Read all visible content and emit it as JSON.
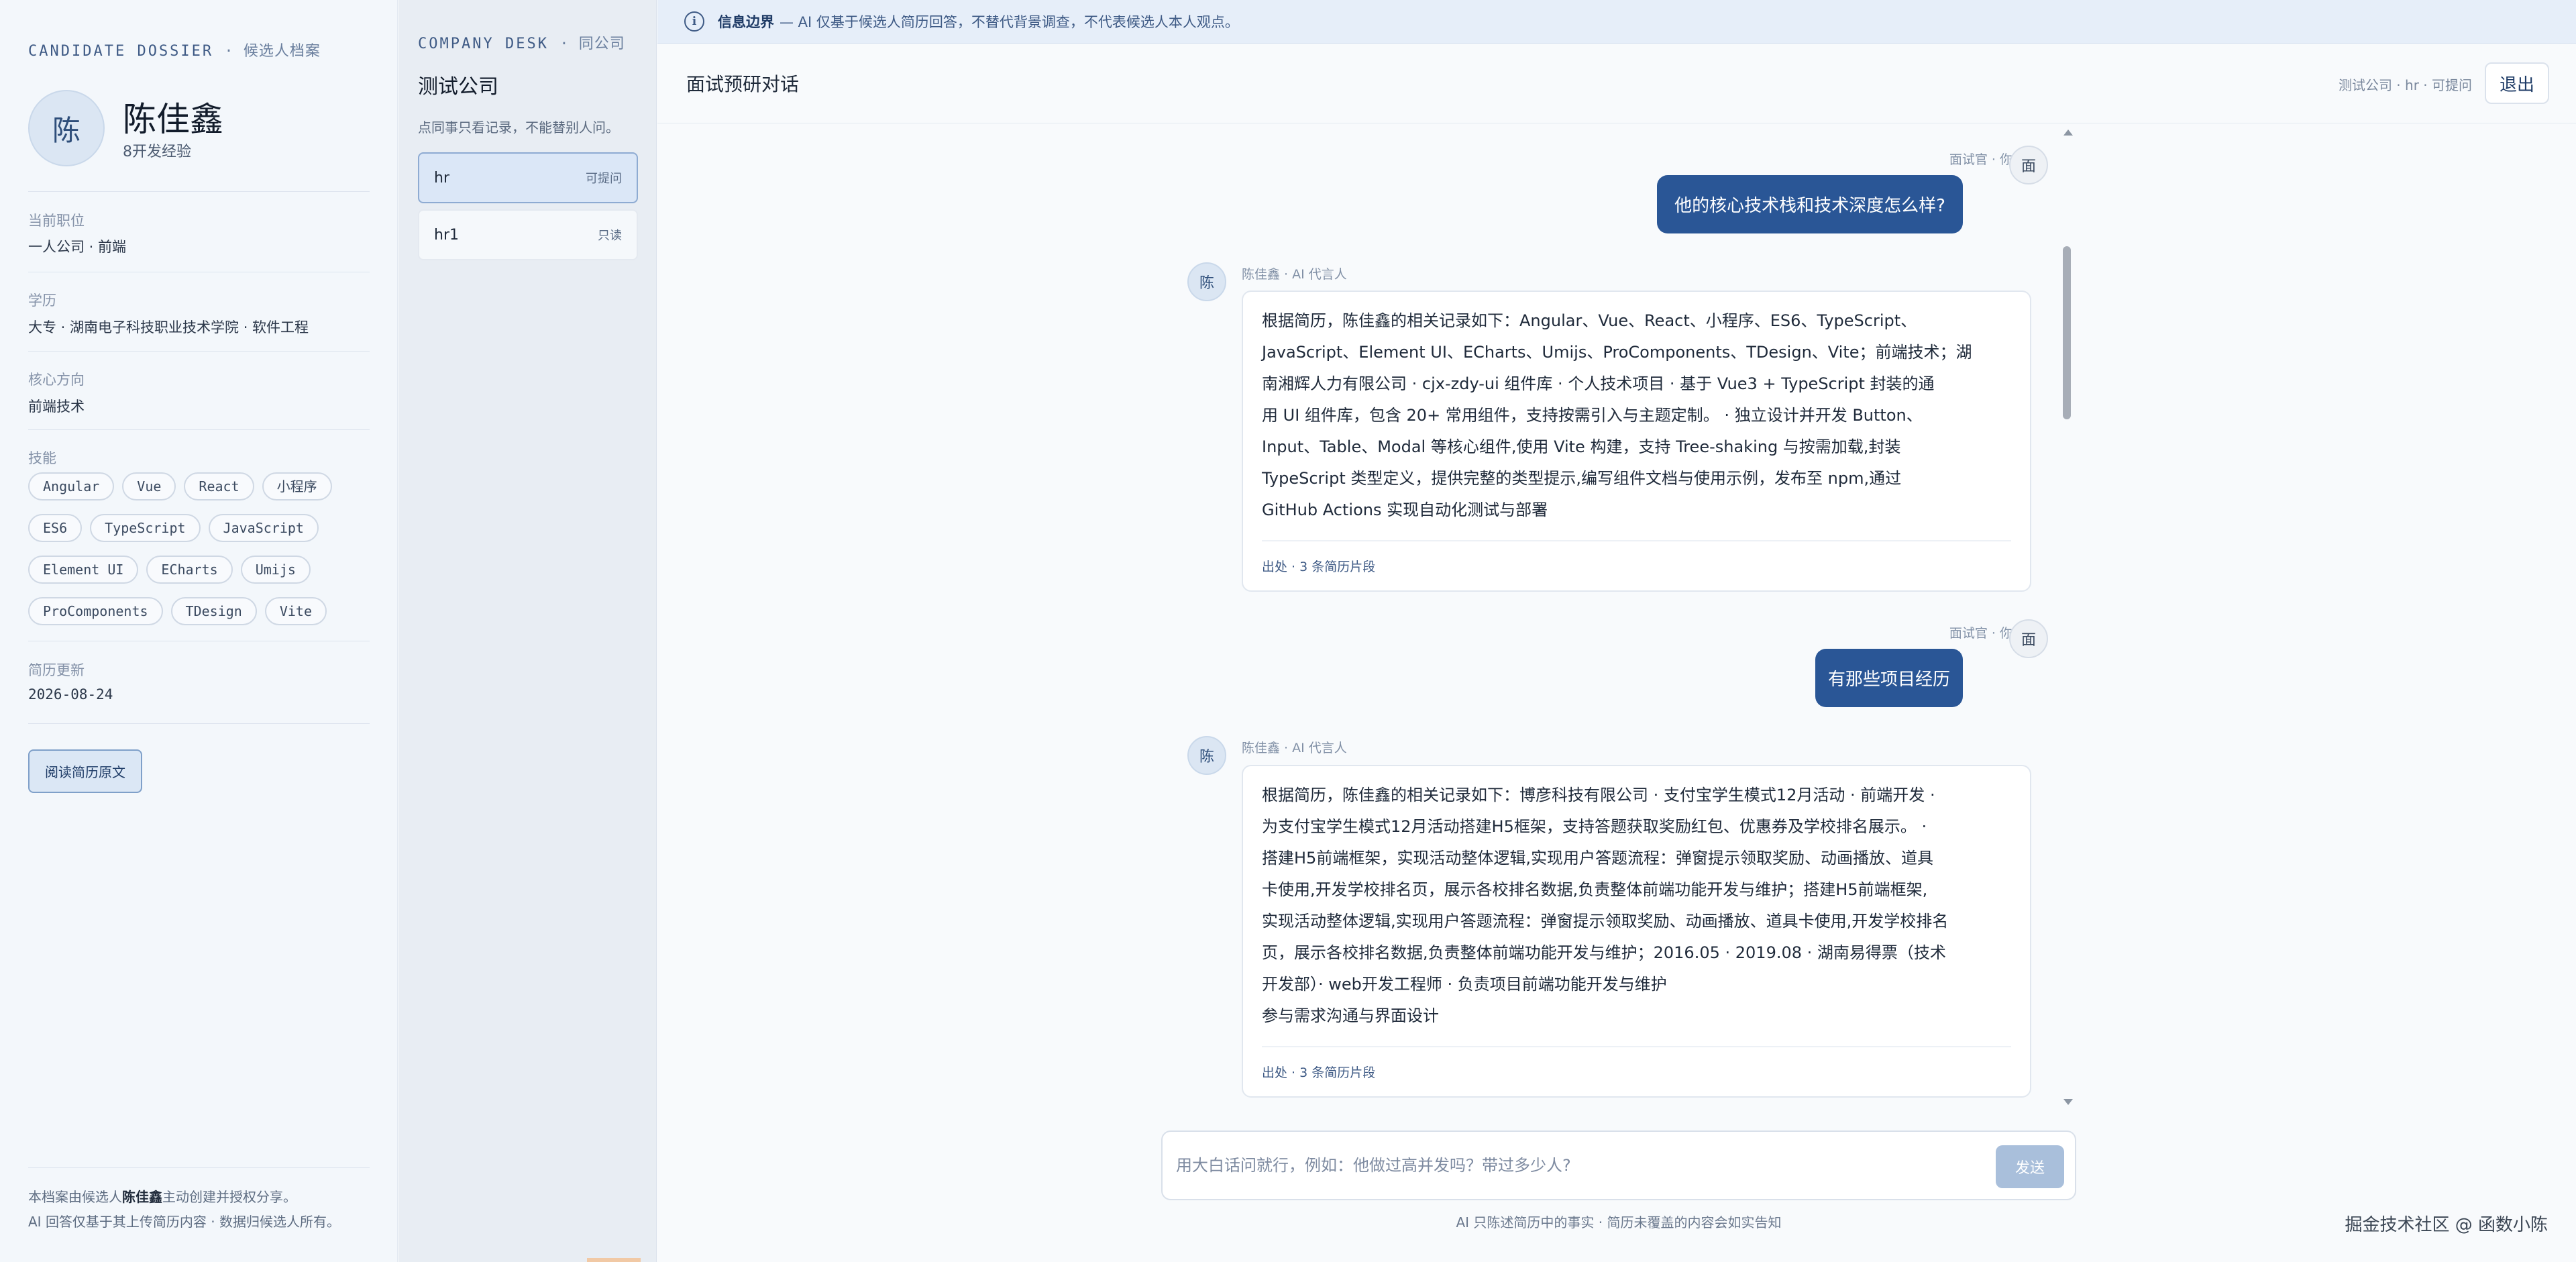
{
  "dossier": {
    "kicker": "CANDIDATE DOSSIER",
    "kicker_cn": "候选人档案",
    "avatar_char": "陈",
    "name": "陈佳鑫",
    "experience": "8开发经验",
    "fields": {
      "position_label": "当前职位",
      "position_value": "一人公司 · 前端",
      "education_label": "学历",
      "education_value": "大专 · 湖南电子科技职业技术学院 · 软件工程",
      "focus_label": "核心方向",
      "focus_value": "前端技术",
      "skills_label": "技能",
      "updated_label": "简历更新",
      "updated_value": "2026-08-24"
    },
    "skills": [
      "Angular",
      "Vue",
      "React",
      "小程序",
      "ES6",
      "TypeScript",
      "JavaScript",
      "Element UI",
      "ECharts",
      "Umijs",
      "ProComponents",
      "TDesign",
      "Vite"
    ],
    "read_button": "阅读简历原文",
    "footer_line1_prefix": "本档案由候选人",
    "footer_line1_name": "陈佳鑫",
    "footer_line1_suffix": "主动创建并授权分享。",
    "footer_line2": "AI 回答仅基于其上传简历内容 · 数据归候选人所有。"
  },
  "desk": {
    "kicker": "COMPANY DESK",
    "kicker_cn": "同公司",
    "title": "测试公司",
    "note": "点同事只看记录，不能替别人问。",
    "users": [
      {
        "name": "hr",
        "perm": "可提问"
      },
      {
        "name": "hr1",
        "perm": "只读"
      }
    ]
  },
  "banner": {
    "strong": "信息边界",
    "text": "— AI 仅基于候选人简历回答，不替代背景调查，不代表候选人本人观点。",
    "icon": "info-icon"
  },
  "header": {
    "title": "面试预研对话",
    "meta": "测试公司 · hr · 可提问",
    "logout": "退出"
  },
  "chat": {
    "messages": [
      {
        "role": "interviewer",
        "meta": "面试官 · 你",
        "avatar": "面",
        "text": "他的核心技术栈和技术深度怎么样?"
      },
      {
        "role": "ai",
        "meta": "陈佳鑫 · AI 代言人",
        "avatar": "陈",
        "text": "根据简历，陈佳鑫的相关记录如下：Angular、Vue、React、小程序、ES6、TypeScript、\nJavaScript、Element UI、ECharts、Umijs、ProComponents、TDesign、Vite；前端技术；湖\n南湘辉人力有限公司 · cjx-zdy-ui 组件库 · 个人技术项目 · 基于 Vue3 + TypeScript 封装的通\n用 UI 组件库，包含 20+ 常用组件，支持按需引入与主题定制。 · 独立设计并开发 Button、\nInput、Table、Modal 等核心组件,使用 Vite 构建，支持 Tree-shaking 与按需加载,封装\nTypeScript 类型定义，提供完整的类型提示,编写组件文档与使用示例，发布至 npm,通过\nGitHub Actions 实现自动化测试与部署",
        "source": "出处 · 3 条简历片段"
      },
      {
        "role": "interviewer",
        "meta": "面试官 · 你",
        "avatar": "面",
        "text": "有那些项目经历"
      },
      {
        "role": "ai",
        "meta": "陈佳鑫 · AI 代言人",
        "avatar": "陈",
        "text": "根据简历，陈佳鑫的相关记录如下：博彦科技有限公司 · 支付宝学生模式12月活动 · 前端开发 ·\n为支付宝学生模式12月活动搭建H5框架，支持答题获取奖励红包、优惠券及学校排名展示。 ·\n搭建H5前端框架，实现活动整体逻辑,实现用户答题流程：弹窗提示领取奖励、动画播放、道具\n卡使用,开发学校排名页，展示各校排名数据,负责整体前端功能开发与维护；搭建H5前端框架,\n实现活动整体逻辑,实现用户答题流程：弹窗提示领取奖励、动画播放、道具卡使用,开发学校排名\n页，展示各校排名数据,负责整体前端功能开发与维护；2016.05 · 2019.08 · 湖南易得票（技术\n开发部）· web开发工程师 · 负责项目前端功能开发与维护\n参与需求沟通与界面设计",
        "source": "出处 · 3 条简历片段"
      }
    ]
  },
  "composer": {
    "placeholder": "用大白话问就行，例如：他做过高并发吗？带过多少人?",
    "send": "发送",
    "hint": "AI 只陈述简历中的事实 · 简历未覆盖的内容会如实告知"
  },
  "watermark": "掘金技术社区 @ 函数小陈"
}
